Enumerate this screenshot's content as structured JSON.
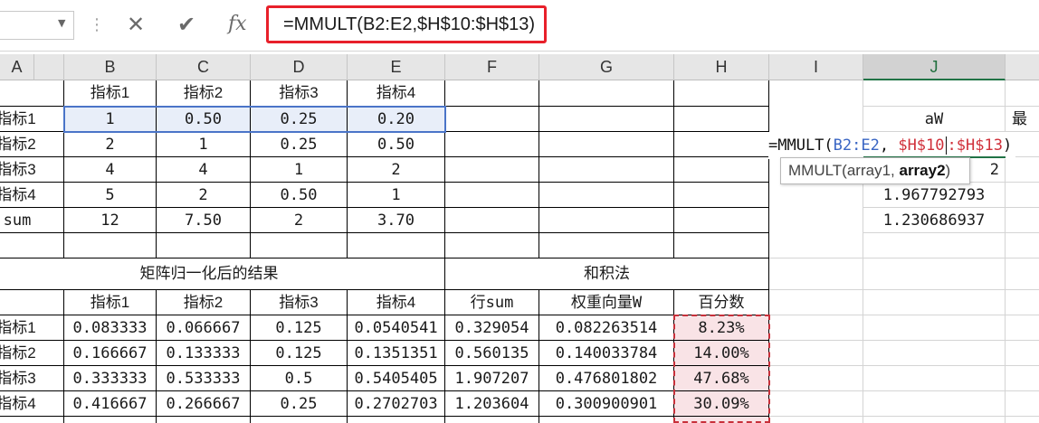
{
  "formula_bar": {
    "name_box_value": "",
    "cancel_icon": "close-icon",
    "enter_icon": "check-icon",
    "fx_label": "fx",
    "formula": "=MMULT(B2:E2,$H$10:$H$13)"
  },
  "columns": [
    "A",
    "B",
    "C",
    "D",
    "E",
    "F",
    "G",
    "H",
    "I",
    "J"
  ],
  "table1": {
    "headers": [
      "指标1",
      "指标2",
      "指标3",
      "指标4"
    ],
    "rows": [
      {
        "label": "指标1",
        "values": [
          "1",
          "0.50",
          "0.25",
          "0.20"
        ]
      },
      {
        "label": "指标2",
        "values": [
          "2",
          "1",
          "0.25",
          "0.50"
        ]
      },
      {
        "label": "指标3",
        "values": [
          "4",
          "4",
          "1",
          "2"
        ]
      },
      {
        "label": "指标4",
        "values": [
          "5",
          "2",
          "0.50",
          "1"
        ]
      },
      {
        "label": "sum",
        "values": [
          "12",
          "7.50",
          "2",
          "3.70"
        ]
      }
    ]
  },
  "section_titles": {
    "normalized": "矩阵归一化后的结果",
    "sum_product": "和积法"
  },
  "table2": {
    "headers": [
      "指标1",
      "指标2",
      "指标3",
      "指标4",
      "行sum",
      "权重向量W",
      "百分数"
    ],
    "rows": [
      {
        "label": "指标1",
        "values": [
          "0.083333",
          "0.066667",
          "0.125",
          "0.0540541",
          "0.329054",
          "0.082263514",
          "8.23%"
        ]
      },
      {
        "label": "指标2",
        "values": [
          "0.166667",
          "0.133333",
          "0.125",
          "0.1351351",
          "0.560135",
          "0.140033784",
          "14.00%"
        ]
      },
      {
        "label": "指标3",
        "values": [
          "0.333333",
          "0.533333",
          "0.5",
          "0.5405405",
          "1.907207",
          "0.476801802",
          "47.68%"
        ]
      },
      {
        "label": "指标4",
        "values": [
          "0.416667",
          "0.266667",
          "0.25",
          "0.2702703",
          "1.203604",
          "0.300900901",
          "30.09%"
        ]
      }
    ]
  },
  "side": {
    "aw_header": "aW",
    "k_header_partial": "最",
    "edit_formula_prefix": "=MMULT(",
    "edit_ref1": "B2:E2",
    "edit_sep": ", ",
    "edit_ref2a": "$H$10",
    "edit_ref2b": ":$H$13",
    "edit_close": ")",
    "tooltip_fn": "MMULT(array1, ",
    "tooltip_bold": "array2",
    "tooltip_close": ")",
    "j_row4_partial": "2",
    "j_values": [
      "1.967792793",
      "1.230686937"
    ]
  },
  "colors": {
    "formula_highlight": "#e8202a",
    "ref_blue": "#3a66c4",
    "ref_red": "#d0303a",
    "percent_bg": "#f9e3e6",
    "active_header": "#217346"
  }
}
